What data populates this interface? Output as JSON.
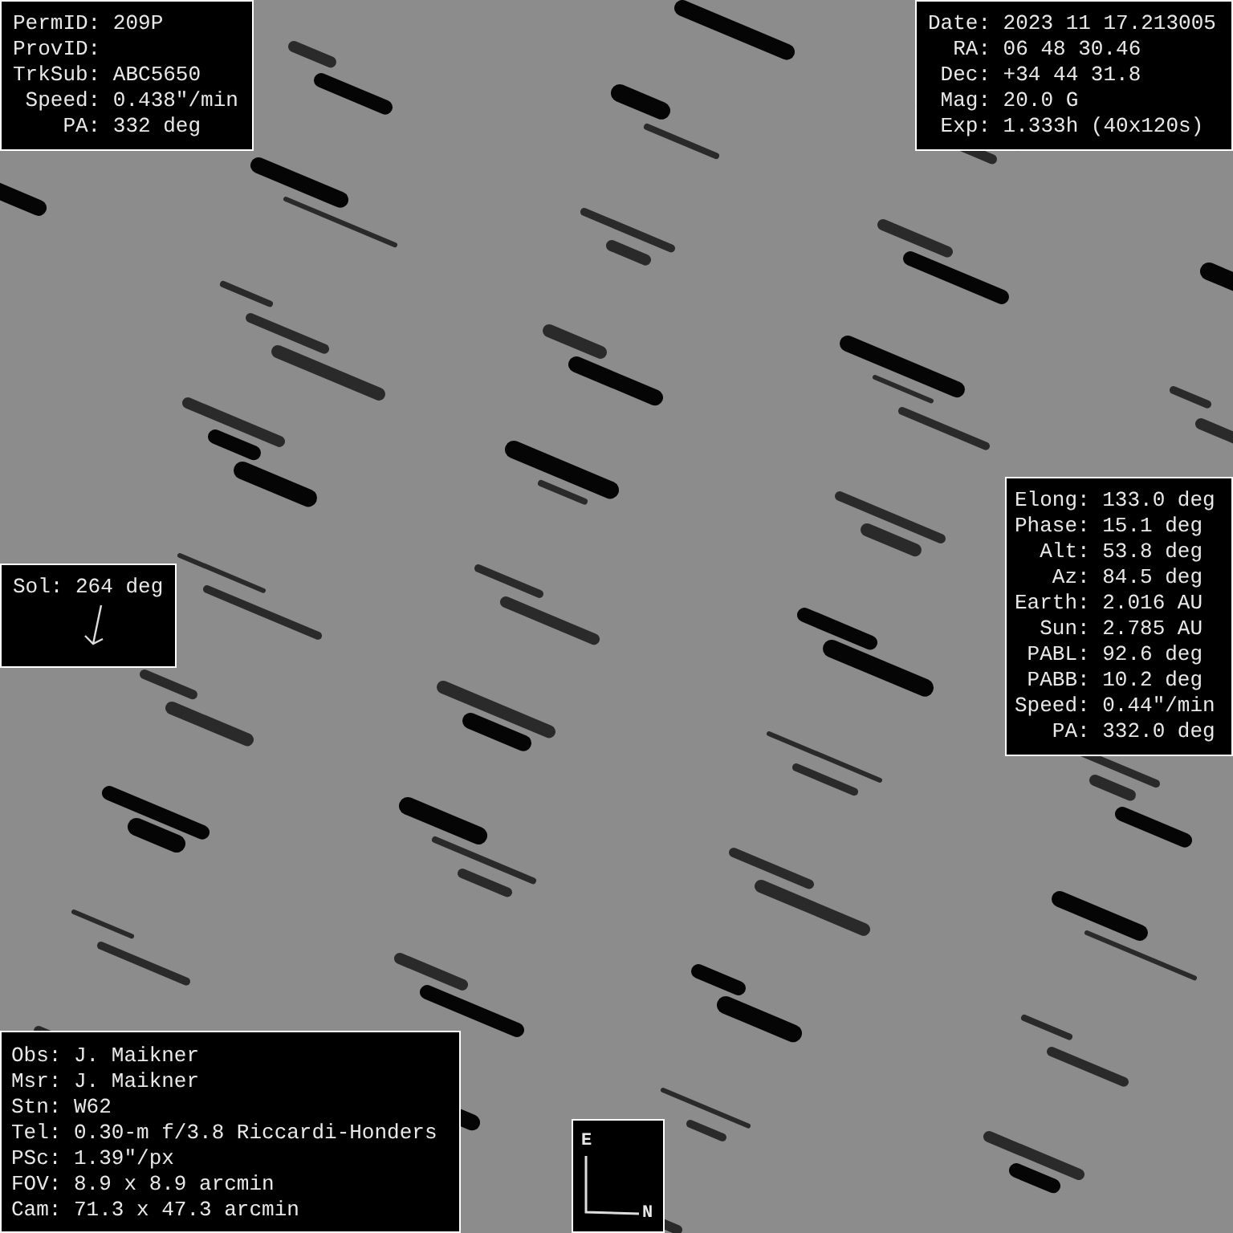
{
  "object_panel": {
    "lines": [
      "PermID: 209P",
      "ProvID:",
      "TrkSub: ABC5650",
      " Speed: 0.438\"/min",
      "    PA: 332 deg"
    ]
  },
  "observation_panel": {
    "lines": [
      "Date: 2023 11 17.213005",
      "  RA: 06 48 30.46",
      " Dec: +34 44 31.8",
      " Mag: 20.0 G",
      " Exp: 1.333h (40x120s)"
    ]
  },
  "geometry_panel": {
    "lines": [
      "Elong: 133.0 deg",
      "Phase: 15.1 deg",
      "  Alt: 53.8 deg",
      "   Az: 84.5 deg",
      "Earth: 2.016 AU",
      "  Sun: 2.785 AU",
      " PABL: 92.6 deg",
      " PABB: 10.2 deg",
      "Speed: 0.44\"/min",
      "   PA: 332.0 deg"
    ]
  },
  "sun_panel": {
    "label": "Sol: 264 deg"
  },
  "station_panel": {
    "lines": [
      "Obs: J. Maikner",
      "Msr: J. Maikner",
      "Stn: W62",
      "Tel: 0.30-m f/3.8 Riccardi-Honders",
      "PSc: 1.39\"/px",
      "FOV: 8.9 x 8.9 arcmin",
      "Cam: 71.3 x 47.3 arcmin"
    ]
  },
  "compass": {
    "east": "E",
    "north": "N"
  }
}
